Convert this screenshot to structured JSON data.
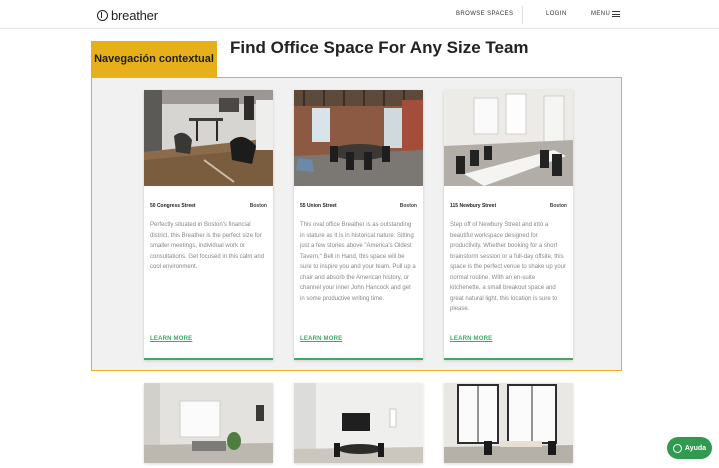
{
  "header": {
    "logo_text": "breather",
    "nav": {
      "browse_label": "BROWSE SPACES",
      "login_label": "LOGIN",
      "menu_label": "MENU"
    }
  },
  "context_tab": {
    "label": "Navegación contextual"
  },
  "page_title": "Find Office Space For Any Size Team",
  "listings": [
    {
      "name": "50 Congress Street",
      "city": "Boston",
      "description": "Perfectly situated in Boston's financial district, this Breather is the perfect size for smaller meetings, individual work or consultations. Get focused in this calm and cool environment.",
      "cta": "LEARN MORE",
      "photo_icon": "office-photo-icon"
    },
    {
      "name": "55 Union Street",
      "city": "Boston",
      "description": "This oval office Breather is as outstanding in stature as it is in historical nature. Sitting just a few stories above \"America's Oldest Tavern,\" Bell in Hand, this space will be sure to inspire you and your team. Pull up a chair and absorb the American history, or channel your inner John Hancock and get in some productive writing time.",
      "cta": "LEARN MORE",
      "photo_icon": "office-photo-icon"
    },
    {
      "name": "115 Newbury Street",
      "city": "Boston",
      "description": "Step off of Newbury Street and into a beautiful workspace designed for productivity. Whether booking for a short brainstorm session or a full-day offsite, this space is the perfect venue to shake up your normal routine. With an en-suite kitchenette, a small breakout space and great natural light, this location is sure to please.",
      "cta": "LEARN MORE",
      "photo_icon": "office-photo-icon"
    }
  ],
  "help_button": {
    "label": "Ayuda",
    "icon": "chat-icon"
  },
  "colors": {
    "accent_yellow": "#e8b018",
    "brand_green": "#3daa63",
    "help_green": "#2f9a50",
    "panel_bg": "#f1f1f1"
  }
}
